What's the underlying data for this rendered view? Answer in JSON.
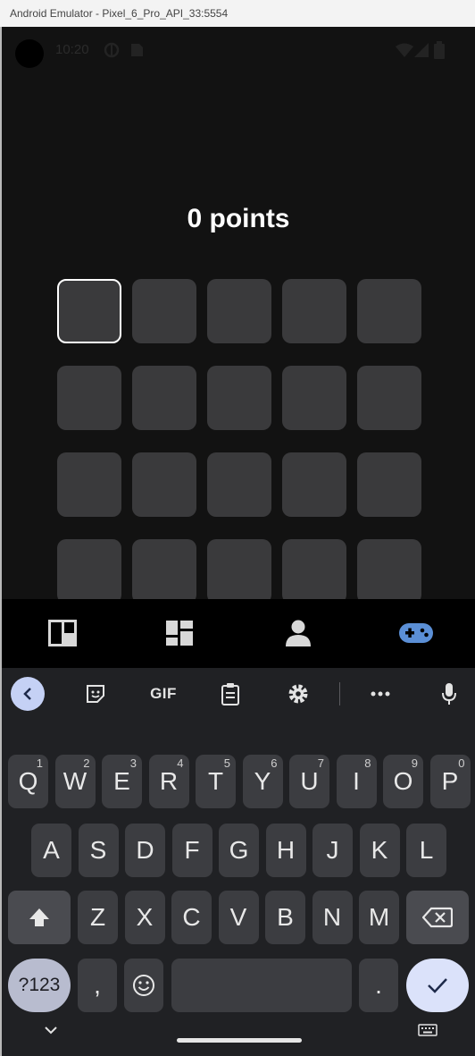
{
  "window": {
    "title": "Android Emulator - Pixel_6_Pro_API_33:5554"
  },
  "status_bar": {
    "time": "10:20"
  },
  "game": {
    "points_label": "0 points",
    "rows": 4,
    "cols": 5,
    "active_tile": 0
  },
  "bottom_nav": {
    "items": [
      {
        "icon": "board-icon",
        "active": false
      },
      {
        "icon": "dashboard-icon",
        "active": false
      },
      {
        "icon": "person-icon",
        "active": false
      },
      {
        "icon": "gamepad-icon",
        "active": true
      }
    ],
    "active_color": "#5b8fd6"
  },
  "keyboard": {
    "toolbar": [
      "back-icon",
      "sticker-icon",
      "GIF",
      "clipboard-icon",
      "settings-icon",
      "more-icon",
      "mic-icon"
    ],
    "gif_label": "GIF",
    "row1": [
      {
        "k": "Q",
        "h": "1"
      },
      {
        "k": "W",
        "h": "2"
      },
      {
        "k": "E",
        "h": "3"
      },
      {
        "k": "R",
        "h": "4"
      },
      {
        "k": "T",
        "h": "5"
      },
      {
        "k": "Y",
        "h": "6"
      },
      {
        "k": "U",
        "h": "7"
      },
      {
        "k": "I",
        "h": "8"
      },
      {
        "k": "O",
        "h": "9"
      },
      {
        "k": "P",
        "h": "0"
      }
    ],
    "row2": [
      "A",
      "S",
      "D",
      "F",
      "G",
      "H",
      "J",
      "K",
      "L"
    ],
    "row3": [
      "Z",
      "X",
      "C",
      "V",
      "B",
      "N",
      "M"
    ],
    "numbers_label": "?123",
    "comma_label": ",",
    "period_label": "."
  }
}
